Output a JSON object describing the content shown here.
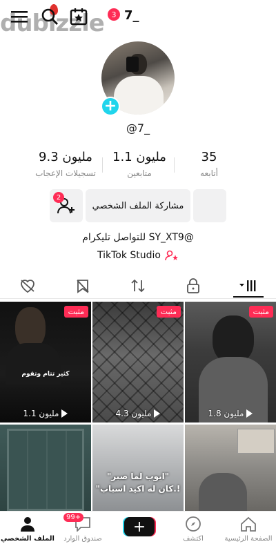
{
  "topbar": {
    "watermark": "dubizzle",
    "notification_count": "3",
    "username": "7_"
  },
  "profile": {
    "handle": "@7_",
    "stats": [
      {
        "value": "35",
        "label": "أتابعه"
      },
      {
        "value": "1.1 مليون",
        "label": "متابعين"
      },
      {
        "value": "9.3 مليون",
        "label": "تسجيلات الإعجاب"
      }
    ],
    "share_button": "مشاركة الملف الشخصي",
    "add_friends_badge": "2",
    "bio": "للتواصل تليكرام SY_XT9@",
    "studio_link": "TikTok Studio"
  },
  "videos": [
    {
      "pinned_label": "مثبت",
      "views": "1.1 مليون",
      "caption": "كثير تتام وتقوم"
    },
    {
      "pinned_label": "مثبت",
      "views": "4.3 مليون",
      "caption": ""
    },
    {
      "pinned_label": "مثبت",
      "views": "1.8 مليون",
      "caption": ""
    },
    {
      "pinned_label": "",
      "views": "",
      "caption": ""
    },
    {
      "pinned_label": "",
      "views": "",
      "caption": "\"ايوب لما صبر\"\n\"كان له اكيد اسباب.!"
    },
    {
      "pinned_label": "",
      "views": "",
      "caption": ""
    }
  ],
  "bottom_nav": {
    "home": "الصفحة الرئيسية",
    "explore": "اكتشف",
    "inbox": "صندوق الوارد",
    "inbox_badge": "99+",
    "profile": "الملف الشخصي"
  },
  "colors": {
    "accent": "#fe2c55",
    "plus": "#20d5ec"
  }
}
